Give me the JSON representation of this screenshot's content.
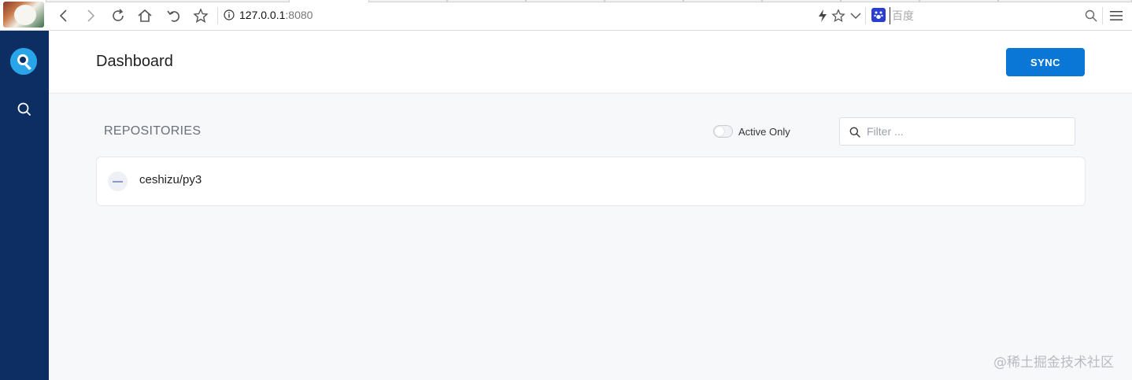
{
  "browser": {
    "url_host": "127.0.0.1",
    "url_port": ":8080",
    "search_placeholder": "百度"
  },
  "header": {
    "title": "Dashboard",
    "sync_label": "SYNC"
  },
  "repositories": {
    "section_title": "REPOSITORIES",
    "active_only_label": "Active Only",
    "active_only_enabled": false,
    "filter_placeholder": "Filter ...",
    "items": [
      {
        "name": "ceshizu/py3",
        "status": "inactive"
      }
    ]
  },
  "watermark": "@稀土掘金技术社区",
  "colors": {
    "sidebar": "#0c2e63",
    "accent": "#0a76d6",
    "logo": "#29a4e8"
  },
  "icons": {
    "sidebar": [
      "logo-icon",
      "search-icon"
    ],
    "browser": [
      "back-icon",
      "forward-icon",
      "reload-icon",
      "home-icon",
      "undo-icon",
      "star-icon",
      "info-icon",
      "lightning-icon",
      "chevron-down-icon",
      "search-icon",
      "menu-icon"
    ]
  }
}
